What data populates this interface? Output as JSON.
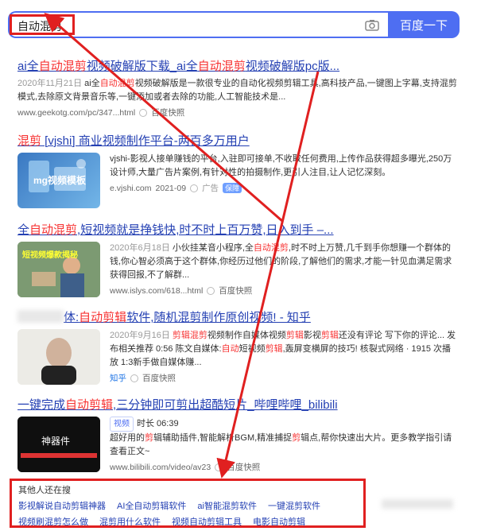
{
  "search": {
    "query": "自动混剪",
    "button": "百度一下"
  },
  "results": [
    {
      "title": [
        "ai全",
        "自动混剪",
        "视频破解版下载_ai全",
        "自动混剪",
        "视频破解版pc版..."
      ],
      "date": "2020年11月21日",
      "desc": [
        "ai全",
        "自动混剪",
        "视频破解版是一款很专业的自动化视频剪辑工具,高科技产品,一键图上字幕,支持混剪模式,去除原文背景音乐等,一键添加或者去除的功能,人工智能技术是..."
      ],
      "url": "www.geekotg.com/pc/347...html",
      "snapshot": "百度快照"
    },
    {
      "title": [
        "混剪",
        " [vjshi] 商业视频制作平台-两百多万用户"
      ],
      "thumb_text": "mg视频模板",
      "desc": "vjshi-影视人接单赚钱的平台,入驻即可接单,不收取任何费用,上传作品获得超多曝光,250万设计师,大量广告片案例,有针对性的拍摄制作,更引人注目,让人记忆深刻。",
      "url": "e.vjshi.com",
      "date": "2021-09",
      "ad": "广告",
      "badge": "保障"
    },
    {
      "title": [
        "全",
        "自动混剪",
        ",短视频就是挣钱快,时不时上百万赞,日入到手 ‒..."
      ],
      "thumb_text": "短视频爆款揭秘",
      "date": "2020年6月18日",
      "desc": [
        "小伙挂某音小程序,全",
        "自动混剪",
        ",时不时上万赞,几千到手你想赚一个群体的钱,你心智必须高于这个群体,你经历过他们的阶段,了解他们的需求,才能一针见血满足需求获得回报,不了解群..."
      ],
      "url": "www.islys.com/618...html",
      "snapshot": "百度快照"
    },
    {
      "title": [
        "体:",
        "自动剪辑",
        "软件,随机混剪制作原创视频! - 知乎"
      ],
      "date": "2020年9月16日",
      "desc": [
        "剪辑混剪",
        "视频制作自媒体视频",
        "剪辑",
        "影视",
        "剪辑",
        "还没有评论 写下你的评论... 发布相关推荐 0:56 陈文自媒体:",
        "自动",
        "短视频",
        "剪辑",
        ",轰屏变横屏的技巧! 核裂式网络 · 1915 次播放 1:3",
        "新手做自媒体赚..."
      ],
      "source": "知乎",
      "snapshot": "百度快照"
    },
    {
      "title": [
        "一键完成",
        "自动剪辑",
        ",三分钟即可剪出超酷短片_哔哩哔哩_bilibili"
      ],
      "thumb_text": "神器件",
      "video_tag": "视频",
      "duration": "时长 06:39",
      "desc": [
        "超好用的",
        "剪",
        "辑辅助插件,智能解析BGM,精准捕捉",
        "剪",
        "辑点,帮你快速出大片。更多教学指引请查看",
        "正文~"
      ],
      "url": "www.bilibili.com/video/av23",
      "snapshot": "百度快照"
    }
  ],
  "others": {
    "title": "其他人还在搜",
    "row1": [
      "影视解说自动剪辑神器",
      "AI全自动剪辑软件",
      "ai智能混剪软件",
      "一键混剪软件"
    ],
    "row2": [
      "视频刷混剪怎么做",
      "混剪用什么软件",
      "视频自动剪辑工具",
      "电影自动剪辑"
    ]
  },
  "colors": {
    "accent": "#4e6ef2",
    "link": "#2440b3",
    "highlight": "#f73131",
    "annotation": "#e02020"
  }
}
